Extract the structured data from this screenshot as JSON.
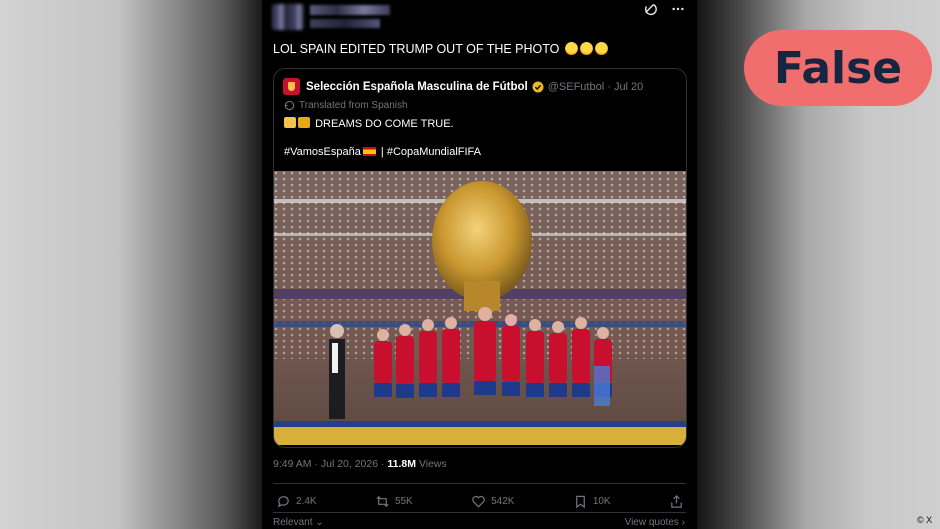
{
  "post": {
    "text": "LOL SPAIN EDITED TRUMP OUT OF THE PHOTO"
  },
  "quoted": {
    "name": "Selección Española Masculina de Fútbol",
    "handle": "@SEFutbol · Jul 20",
    "translated": "Translated from Spanish",
    "line1": "DREAMS DO COME TRUE.",
    "hashtag1": "#VamosEspaña",
    "hashtag2": "| #CopaMundialFIFA"
  },
  "meta": {
    "time": "9:49 AM · Jul 20, 2026 ·",
    "views_count": "11.8M",
    "views_label": "Views"
  },
  "actions": {
    "replies": "2.4K",
    "reposts": "55K",
    "likes": "542K",
    "bookmarks": "10K"
  },
  "footer": {
    "relevant": "Relevant",
    "view_quotes": "View quotes"
  },
  "verdict": "False",
  "credit": "X",
  "colors": {
    "verdict_bg": "#f06e6e",
    "verdict_text": "#162640",
    "verified": "#e8b923"
  },
  "icons": [
    "grok-icon",
    "more-icon",
    "translate-icon",
    "reply-icon",
    "repost-icon",
    "like-icon",
    "bookmark-icon",
    "share-icon"
  ]
}
